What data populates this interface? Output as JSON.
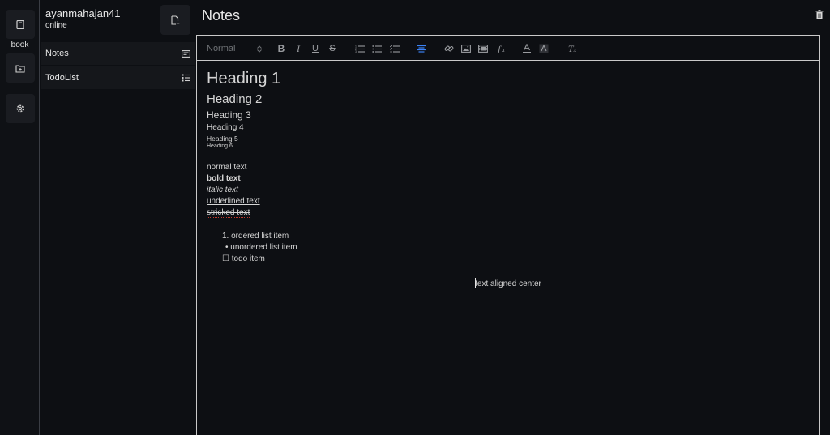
{
  "rail": {
    "book_label": "book"
  },
  "sidebar": {
    "username": "ayanmahajan41",
    "status": "online",
    "items": [
      {
        "label": "Notes",
        "icon": "note-icon"
      },
      {
        "label": "TodoList",
        "icon": "checklist-icon"
      }
    ]
  },
  "main": {
    "title": "Notes"
  },
  "toolbar": {
    "format_value": "Normal",
    "buttons": [
      "bold",
      "italic",
      "underline",
      "strike",
      "ordered-list",
      "bullet-list",
      "check-list",
      "align-center",
      "link",
      "image",
      "video",
      "formula",
      "text-color",
      "background-color",
      "clear-formatting"
    ],
    "accent": "#3b82f6"
  },
  "content": {
    "h1": "Heading 1",
    "h2": "Heading 2",
    "h3": "Heading 3",
    "h4": "Heading 4",
    "h5": "Heading 5",
    "h6": "Heading 6",
    "normal": "normal text",
    "bold": "bold text",
    "italic": "italic text",
    "underline": "underlined text",
    "strike": "stricked text",
    "ordered_marker": "1.",
    "ordered_item": "ordered list item",
    "unordered_marker": "•",
    "unordered_item": "unordered list item",
    "todo_marker": "☐",
    "todo_item": "todo item",
    "center": "text aligned center"
  }
}
